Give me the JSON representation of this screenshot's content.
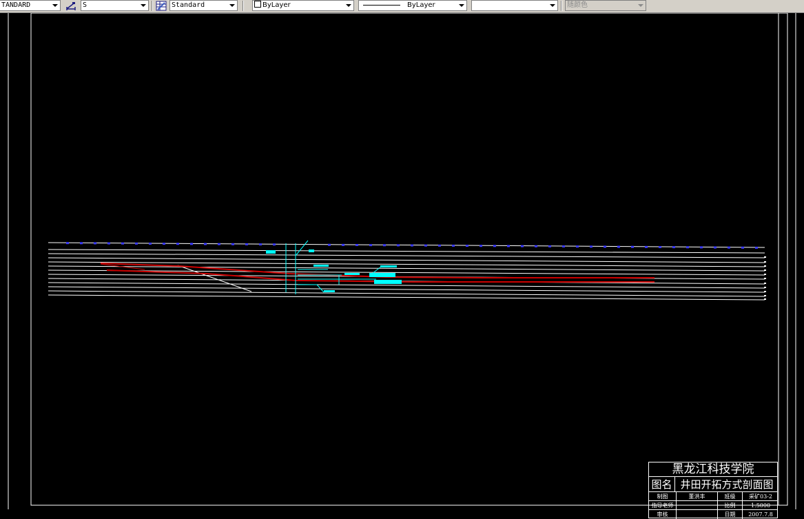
{
  "toolbar": {
    "text_style": "TANDARD",
    "dim_style_icon": "dimension-style-icon",
    "dim_style": "S",
    "table_style_icon": "table-style-icon",
    "table_style": "Standard",
    "layer": "ByLayer",
    "linetype": "ByLayer",
    "lineweight": "",
    "plot_style": "随颜色"
  },
  "title_block": {
    "institution": "黑龙江科技学院",
    "drawing_name_label": "图名",
    "drawing_name": "井田开拓方式剖面图",
    "drawn_by_label": "制图",
    "drawn_by": "董洪丰",
    "class_label": "班级",
    "class_value": "采矿03-2",
    "advisor_label": "指导老师",
    "advisor": "",
    "scale_label": "比例",
    "scale": "1:5000",
    "review_label": "审核",
    "reviewer": "",
    "date_label": "日期",
    "date": "2007.7.8"
  },
  "colors": {
    "background": "#000000",
    "strata_lines": "#ffffff",
    "surface_marks": "#3a3aff",
    "seam": "#cc0000",
    "shaft": "#00ffff"
  }
}
